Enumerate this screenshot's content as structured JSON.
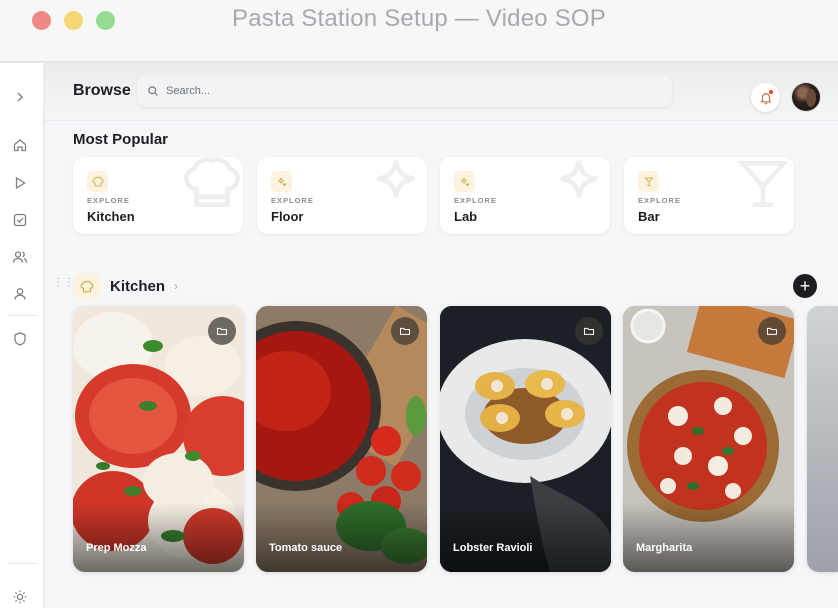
{
  "window": {
    "title": "Pasta Station Setup — Video SOP"
  },
  "topbar": {
    "title": "Browse",
    "search_placeholder": "Search..."
  },
  "popular": {
    "title": "Most Popular",
    "cards": [
      {
        "kicker": "EXPLORE",
        "name": "Kitchen",
        "icon": "chef-hat-icon"
      },
      {
        "kicker": "EXPLORE",
        "name": "Floor",
        "icon": "sparkle-icon"
      },
      {
        "kicker": "EXPLORE",
        "name": "Lab",
        "icon": "sparkle-icon"
      },
      {
        "kicker": "EXPLORE",
        "name": "Bar",
        "icon": "cocktail-icon"
      }
    ]
  },
  "kitchen_row": {
    "title": "Kitchen",
    "videos": [
      {
        "label": "Prep Mozza"
      },
      {
        "label": "Tomato sauce"
      },
      {
        "label": "Lobster Ravioli"
      },
      {
        "label": "Margharita"
      }
    ]
  },
  "colors": {
    "accent_soft": "#fbf3df",
    "accent_icon": "#d6b04d",
    "notification_dot": "#e04a2f",
    "text_primary": "#1c1e22"
  }
}
